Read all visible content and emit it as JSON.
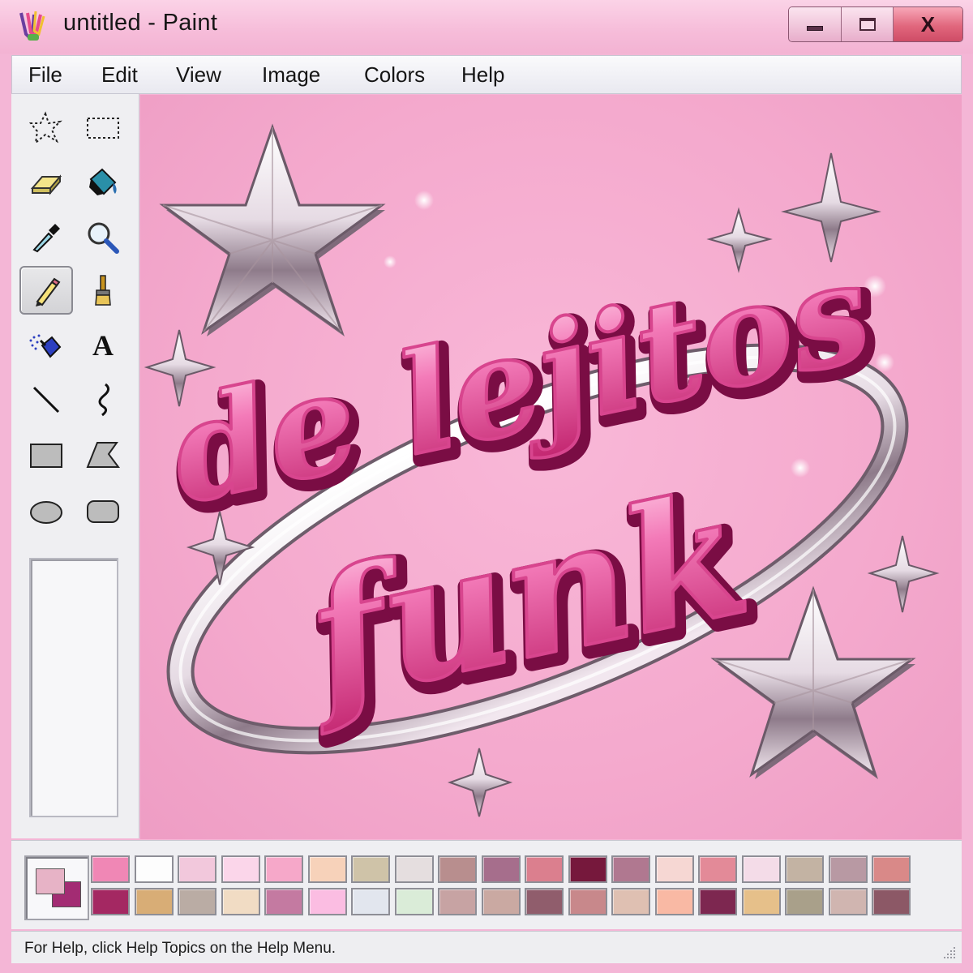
{
  "window": {
    "title": "untitled - Paint",
    "controls": {
      "minimize": "minimize-icon",
      "maximize": "maximize-icon",
      "close_glyph": "X"
    }
  },
  "menu": {
    "items": [
      "File",
      "Edit",
      "View",
      "Image",
      "Colors",
      "Help"
    ]
  },
  "tools": [
    {
      "name": "free-form-select",
      "icon": "free-form-select-icon"
    },
    {
      "name": "select",
      "icon": "rect-select-icon"
    },
    {
      "name": "eraser",
      "icon": "eraser-icon"
    },
    {
      "name": "fill-with-color",
      "icon": "paint-bucket-icon"
    },
    {
      "name": "pick-color",
      "icon": "eyedropper-icon"
    },
    {
      "name": "magnifier",
      "icon": "magnifier-icon"
    },
    {
      "name": "pencil",
      "icon": "pencil-icon",
      "selected": true
    },
    {
      "name": "brush",
      "icon": "brush-icon"
    },
    {
      "name": "airbrush",
      "icon": "airbrush-icon"
    },
    {
      "name": "text",
      "icon": "text-icon",
      "glyph": "A"
    },
    {
      "name": "line",
      "icon": "line-icon"
    },
    {
      "name": "curve",
      "icon": "curve-icon"
    },
    {
      "name": "rectangle",
      "icon": "rectangle-icon"
    },
    {
      "name": "polygon",
      "icon": "polygon-icon"
    },
    {
      "name": "ellipse",
      "icon": "ellipse-icon"
    },
    {
      "name": "rounded-rectangle",
      "icon": "rounded-rectangle-icon"
    }
  ],
  "canvas_art": {
    "line1": "de lejitos",
    "line2": "funk",
    "colors": {
      "text": "#f06aae",
      "text_dark": "#b01765",
      "chrome": "#ebe2ea",
      "chrome_dark": "#7d6b7a"
    }
  },
  "palette": {
    "foreground": "#e7b3c6",
    "background": "#a32c73",
    "row1": [
      "#f087b5",
      "#fdfdfd",
      "#f2c8dc",
      "#fbd6ea",
      "#f6a8c9",
      "#f7d2ba",
      "#cfc3a8",
      "#e5dedf",
      "#b88e8e",
      "#a66e8c",
      "#db7f8e",
      "#76183c",
      "#b07890",
      "#f6d7d3",
      "#e38a98",
      "#f4dce8",
      "#c3b3a3",
      "#b899a3",
      "#d98988"
    ],
    "row2": [
      "#a42862",
      "#d8ad76",
      "#baaca4",
      "#f1dcc4",
      "#c47aa1",
      "#fbbde2",
      "#e2e6ee",
      "#daecd8",
      "#c7a3a3",
      "#caa9a2",
      "#905d6c",
      "#c8888b",
      "#dfc0b2",
      "#f9b9a4",
      "#7d2750",
      "#e6c08a",
      "#a9a08a",
      "#d0b5b0",
      "#8c5866"
    ]
  },
  "status": {
    "text": "For Help, click Help Topics on the Help Menu."
  }
}
